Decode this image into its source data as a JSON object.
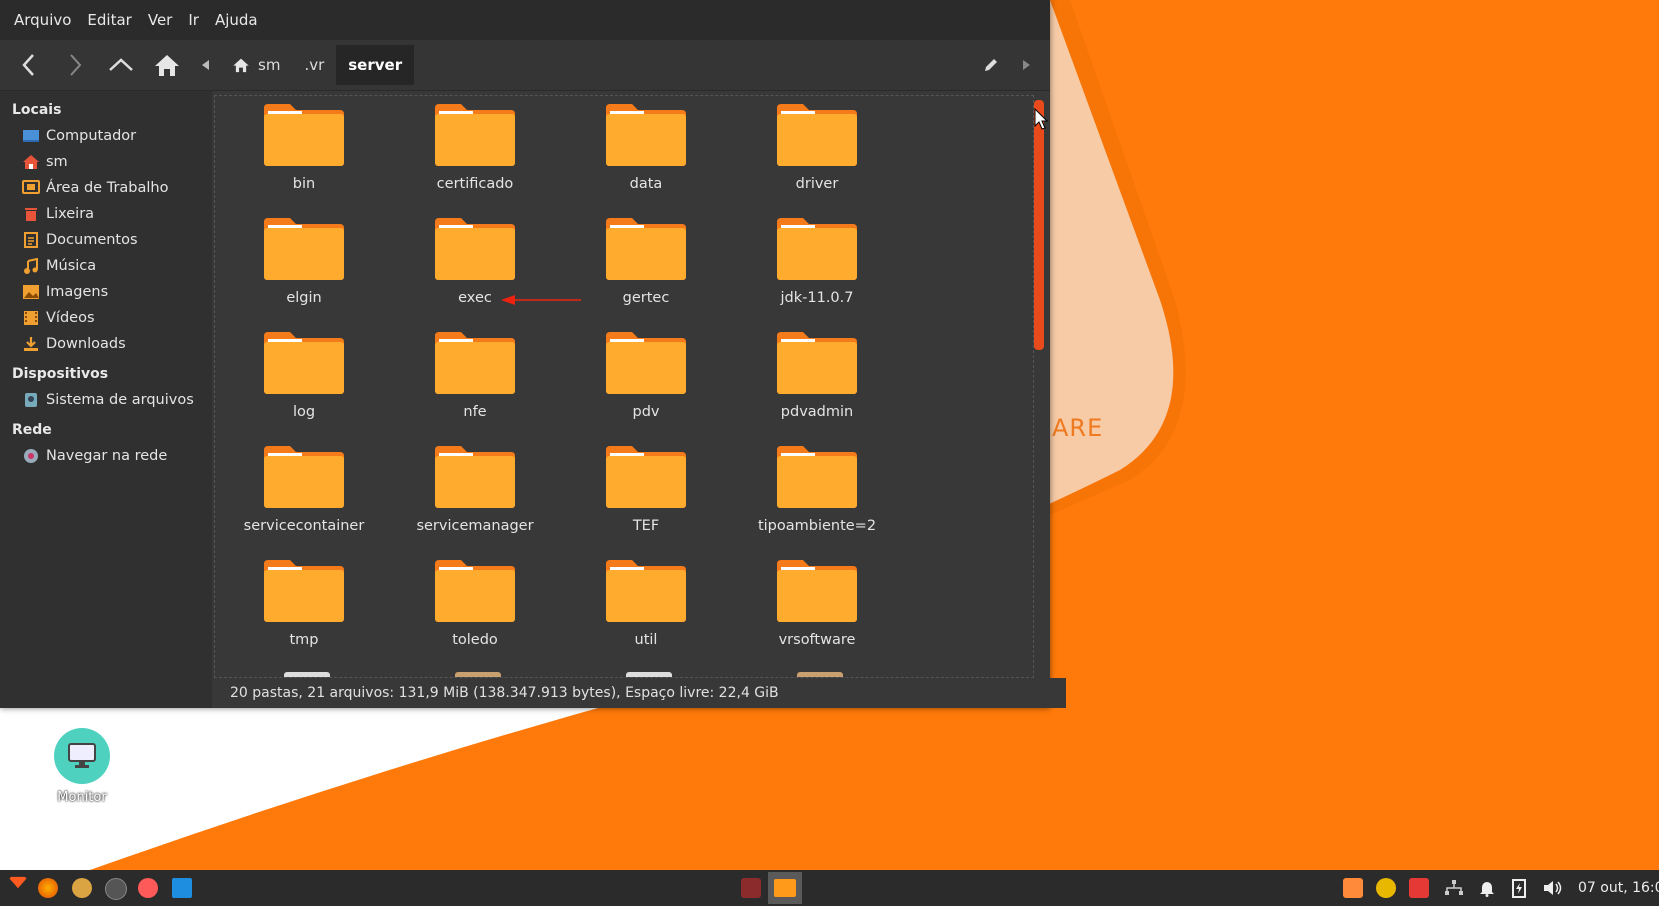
{
  "desktop": {
    "brand_text": "ARE",
    "icon": {
      "label": "Monitor",
      "icon": "monitor-icon"
    }
  },
  "menubar": [
    "Arquivo",
    "Editar",
    "Ver",
    "Ir",
    "Ajuda"
  ],
  "pathbar": {
    "crumbs": [
      "sm",
      ".vr",
      "server"
    ],
    "active": "server"
  },
  "sidebar": {
    "sections": [
      {
        "title": "Locais",
        "items": [
          {
            "label": "Computador",
            "icon": "computer-icon"
          },
          {
            "label": "sm",
            "icon": "home-icon"
          },
          {
            "label": "Área de Trabalho",
            "icon": "desktop-icon"
          },
          {
            "label": "Lixeira",
            "icon": "trash-icon"
          },
          {
            "label": "Documentos",
            "icon": "documents-icon"
          },
          {
            "label": "Música",
            "icon": "music-icon"
          },
          {
            "label": "Imagens",
            "icon": "images-icon"
          },
          {
            "label": "Vídeos",
            "icon": "videos-icon"
          },
          {
            "label": "Downloads",
            "icon": "downloads-icon"
          }
        ]
      },
      {
        "title": "Dispositivos",
        "items": [
          {
            "label": "Sistema de arquivos",
            "icon": "drive-icon"
          }
        ]
      },
      {
        "title": "Rede",
        "items": [
          {
            "label": "Navegar na rede",
            "icon": "network-icon"
          }
        ]
      }
    ]
  },
  "folders": [
    "bin",
    "certificado",
    "data",
    "driver",
    "elgin",
    "exec",
    "gertec",
    "jdk-11.0.7",
    "log",
    "nfe",
    "pdv",
    "pdvadmin",
    "servicecontainer",
    "servicemanager",
    "TEF",
    "tipoambiente=2",
    "tmp",
    "toledo",
    "util",
    "vrsoftware"
  ],
  "status": "20 pastas, 21 arquivos: 131,9 MiB (138.347.913 bytes), Espaço livre: 22,4 GiB",
  "taskbar": {
    "clock": "07 out, 16:0"
  },
  "colors": {
    "folder": "#ffab2e",
    "folder_tab": "#f57a1a",
    "wallpaper_orange": "#ff7a0a",
    "scrollbar": "#e84a1c"
  }
}
